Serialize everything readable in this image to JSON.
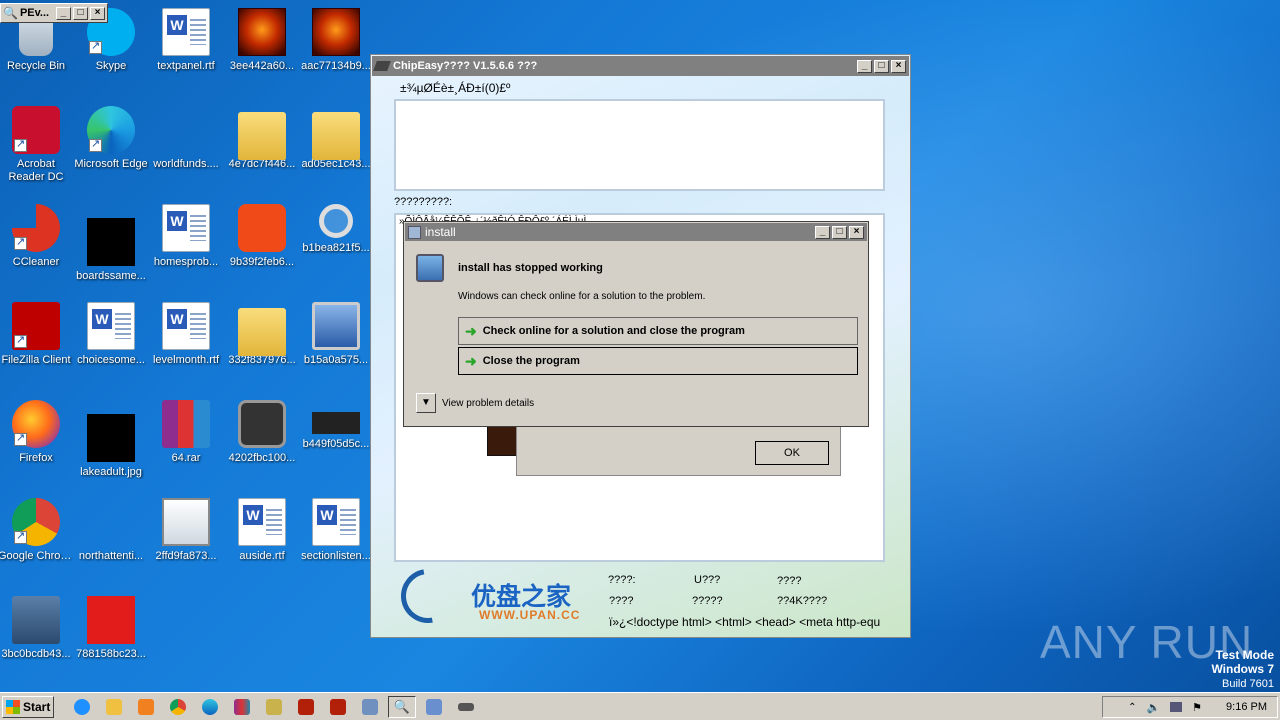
{
  "desktop": {
    "icons": [
      {
        "label": "Recycle Bin",
        "icon": "recycle-bin-icon"
      },
      {
        "label": "Skype",
        "icon": "skype-icon"
      },
      {
        "label": "textpanel.rtf",
        "icon": "word-document-icon"
      },
      {
        "label": "3ee442a60...",
        "icon": "fire-horse-icon"
      },
      {
        "label": "aac77134b9...",
        "icon": "fire-horse-icon"
      },
      {
        "label": "Acrobat Reader DC",
        "icon": "acrobat-icon"
      },
      {
        "label": "Microsoft Edge",
        "icon": "edge-icon"
      },
      {
        "label": "worldfunds....",
        "icon": "blank-file-icon"
      },
      {
        "label": "4e7dc7f446...",
        "icon": "folder-icon"
      },
      {
        "label": "ad05ec1c43...",
        "icon": "folder-icon"
      },
      {
        "label": "CCleaner",
        "icon": "ccleaner-icon"
      },
      {
        "label": "boardssame...",
        "icon": "black-image-icon"
      },
      {
        "label": "homesprob...",
        "icon": "word-document-icon"
      },
      {
        "label": "9b39f2feb6...",
        "icon": "sogou-icon"
      },
      {
        "label": "b1bea821f5...",
        "icon": "magnifier-icon"
      },
      {
        "label": "FileZilla Client",
        "icon": "filezilla-icon"
      },
      {
        "label": "choicesome...",
        "icon": "word-document-icon"
      },
      {
        "label": "levelmonth.rtf",
        "icon": "word-document-icon"
      },
      {
        "label": "332f837976...",
        "icon": "folder-icon"
      },
      {
        "label": "b15a0a575...",
        "icon": "monitor-shield-icon"
      },
      {
        "label": "Firefox",
        "icon": "firefox-icon"
      },
      {
        "label": "lakeadult.jpg",
        "icon": "black-image-icon"
      },
      {
        "label": "64.rar",
        "icon": "winrar-icon"
      },
      {
        "label": "4202fbc100...",
        "icon": "sandboxie-icon"
      },
      {
        "label": "b449f05d5c...",
        "icon": "chip-shield-icon"
      },
      {
        "label": "Google Chrome",
        "icon": "chrome-icon"
      },
      {
        "label": "northattenti...",
        "icon": "blank-file-icon"
      },
      {
        "label": "2ffd9fa873...",
        "icon": "image-shield-icon"
      },
      {
        "label": "auside.rtf",
        "icon": "word-document-icon"
      },
      {
        "label": "sectionlisten...",
        "icon": "word-document-icon"
      },
      {
        "label": "3bc0bcdb43...",
        "icon": "installer-icon"
      },
      {
        "label": "788158bc23...",
        "icon": "adobe-icon"
      }
    ]
  },
  "pev_window": {
    "title": "PEv..."
  },
  "chipeasy": {
    "title": "ChipEasy???? V1.5.6.6 ???",
    "header_text": "±¾µØÉè±¸ÁÐ±í(0)£º",
    "section_label": "?????????:",
    "log_text": "»ÕÌÔÂå¼ÊÊÕÊ ¿´½ðÊ¹Ó ÊÐÔ£º¸´ÁÉÌ·ÌµÌ",
    "footer": {
      "brand_cn": "优盘之家",
      "brand_url": "WWW.UPAN.CC",
      "cells": [
        "????:",
        "U???",
        "????",
        "????",
        "?????",
        "??4K????"
      ],
      "marquee": "ï»¿<!doctype html> <html> <head> <meta http-equ"
    }
  },
  "ok_dialog": {
    "ok_label": "OK"
  },
  "crash_dialog": {
    "title": "install",
    "heading": "install has stopped working",
    "description": "Windows can check online for a solution to the problem.",
    "option_check": "Check online for a solution and close the program",
    "option_close": "Close the program",
    "details_label": "View problem details"
  },
  "taskbar": {
    "start_label": "Start",
    "clock": "9:16 PM"
  },
  "watermark": {
    "brand": "ANY RUN",
    "mode": "Test Mode",
    "os": "Windows 7",
    "build": "Build 7601"
  },
  "colors": {
    "accent_title": "#0a246a",
    "desktop_blue": "#1479d6",
    "green_arrow": "#2aa52a"
  }
}
